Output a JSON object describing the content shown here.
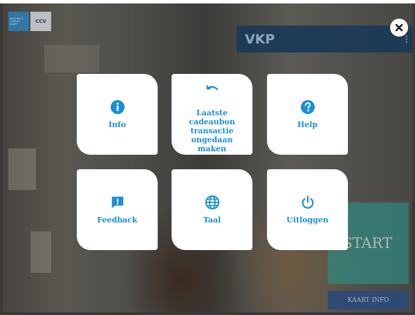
{
  "header": {
    "logo_lines": [
      "NATIONALE",
      "CADEAU",
      "KAART"
    ],
    "ccv_logo": "CCV",
    "title": "VKP",
    "menu_icon": "vertical-dots-icon"
  },
  "close_icon": "close-icon",
  "menu": {
    "tiles": [
      {
        "label": "Info",
        "icon": "info-icon"
      },
      {
        "label": "Laatste cadeaubon transactie ongedaan maken",
        "icon": "undo-icon"
      },
      {
        "label": "Help",
        "icon": "help-icon"
      },
      {
        "label": "Feedback",
        "icon": "feedback-icon"
      },
      {
        "label": "Taal",
        "icon": "globe-icon"
      },
      {
        "label": "Uitloggen",
        "icon": "power-icon"
      }
    ]
  },
  "background": {
    "start_label": "START",
    "kaart_info_label": "KAART INFO"
  },
  "colors": {
    "accent": "#1a8fd6",
    "header_bar": "#1b3a57",
    "start_panel": "#2f8a82",
    "kaart_button": "#2c4a78"
  }
}
